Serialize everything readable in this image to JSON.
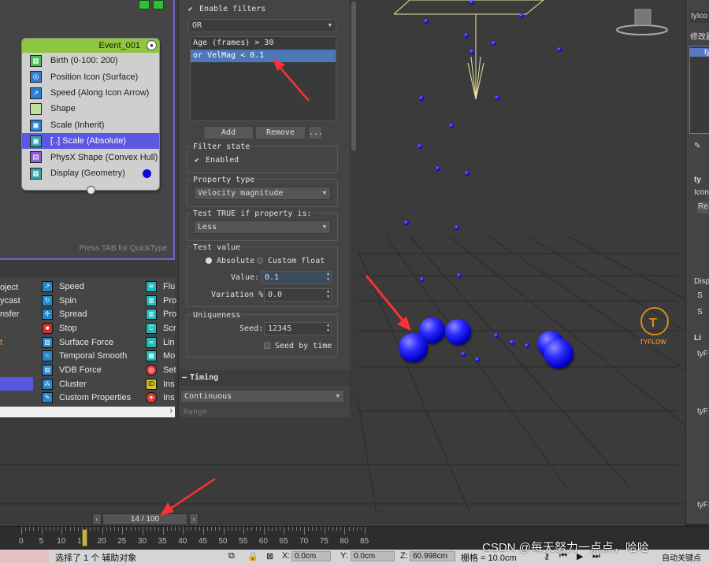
{
  "colors": {
    "accent_selection": "#5a58e0",
    "event_header": "#8ec63f",
    "filter_selection": "#4d78b8",
    "particle_blue": "#1a1aff",
    "annotation_red": "#ff3030"
  },
  "pf_editor": {
    "event": {
      "title": "Event_001",
      "operators": [
        {
          "label": "Birth (0-100: 200)",
          "icon": "birth-icon"
        },
        {
          "label": "Position Icon (Surface)",
          "icon": "position-icon"
        },
        {
          "label": "Speed (Along Icon Arrow)",
          "icon": "speed-icon"
        },
        {
          "label": "Shape",
          "icon": "shape-icon"
        },
        {
          "label": "Scale (Inherit)",
          "icon": "scale-icon"
        },
        {
          "label": "[..] Scale (Absolute)",
          "icon": "scale-icon",
          "selected": true
        },
        {
          "label": "PhysX Shape (Convex Hull)",
          "icon": "physx-icon"
        },
        {
          "label": "Display (Geometry)",
          "icon": "display-icon"
        }
      ]
    },
    "quicktype_hint": "Press TAB for QuickType"
  },
  "depot": {
    "col_left": [
      "oject",
      "ycast",
      "nsfer",
      "t"
    ],
    "col_mid": [
      "Speed",
      "Spin",
      "Spread",
      "Stop",
      "Surface Force",
      "Temporal Smooth",
      "VDB Force",
      "Cluster",
      "Custom Properties"
    ],
    "col_right": [
      "Flu",
      "Pro",
      "Pro",
      "Scr",
      "Lin",
      "Mo",
      "Set",
      "Ins",
      "Ins"
    ]
  },
  "properties": {
    "enable_filters": "Enable filters",
    "logic_mode": "OR",
    "filters": [
      "Age (frames) > 30",
      "or VelMag < 0.1"
    ],
    "add": "Add",
    "remove": "Remove",
    "more": "...",
    "filter_state": "Filter state",
    "enabled": "Enabled",
    "property_type_label": "Property type",
    "property_type": "Velocity magnitude",
    "test_true_label": "Test TRUE if property is:",
    "comparison": "Less",
    "test_value_label": "Test value",
    "absolute": "Absolute",
    "custom_float": "Custom float",
    "value_label": "Value:",
    "value": "0.1",
    "variation_label": "Variation %:",
    "variation": "0.0",
    "uniqueness_label": "Uniqueness",
    "seed_label": "Seed:",
    "seed": "12345",
    "seed_by_time": "Seed by time",
    "timing_title": "Timing",
    "timing_mode": "Continuous",
    "range_label": "Range"
  },
  "command_panel": {
    "items": [
      "tyIco",
      "修改器",
      "ty",
      "ty",
      "Icon",
      "Re",
      "Disp",
      "S",
      "S",
      "Li",
      "tyF",
      "tyF",
      "tyF"
    ]
  },
  "timeline": {
    "frame_display": "14 / 100",
    "current_frame": 14,
    "total_frames": 100,
    "ticks": [
      "0",
      "5",
      "10",
      "15",
      "20",
      "25",
      "30",
      "35",
      "40",
      "45",
      "50",
      "55",
      "60",
      "65",
      "70",
      "75",
      "80",
      "85"
    ]
  },
  "status": {
    "selection": "选择了 1 个 辅助对象",
    "x_label": "X:",
    "x_value": "0.0cm",
    "y_label": "Y:",
    "y_value": "0.0cm",
    "z_label": "Z:",
    "z_value": "60.998cm",
    "grid": "栅格 = 10.0cm",
    "autokey": "自动关键点"
  },
  "logo": {
    "text": "TYFLOW"
  },
  "watermark": "CSDN @每天努力一点点，哈哈"
}
